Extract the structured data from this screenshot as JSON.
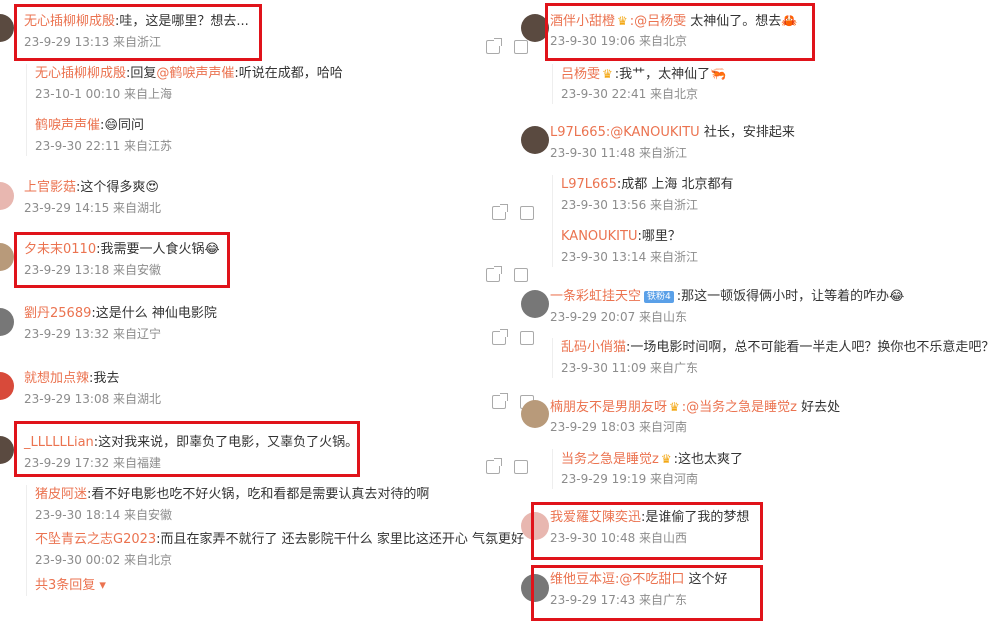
{
  "left": {
    "c1": {
      "name": "无心插柳柳成殷",
      "text": ":哇，这是哪里？想去...",
      "meta": "23-9-29 13:13 来自浙江"
    },
    "c1_replies": [
      {
        "name": "无心插柳柳成殷",
        "pre": ":回复",
        "at": "@鹤唳声声催",
        "text": ":听说在成都，哈哈",
        "meta": "23-10-1 00:10 来自上海"
      },
      {
        "name": "鹤唳声声催",
        "text": ":",
        "emoji": "😄",
        "text2": "同问",
        "meta": "23-9-30 22:11 来自江苏"
      }
    ],
    "c2": {
      "name": "上官影菇",
      "text": ":这个得多爽",
      "emoji": "😍",
      "meta": "23-9-29 14:15 来自湖北"
    },
    "c3": {
      "name": "夕未末0110",
      "text": ":我需要一人食火锅",
      "emoji": "😂",
      "meta": "23-9-29 13:18 来自安徽"
    },
    "c4": {
      "name": "劉丹25689",
      "text": ":这是什么 神仙电影院",
      "meta": "23-9-29 13:32 来自辽宁"
    },
    "c5": {
      "name": "就想加点辣",
      "text": ":我去",
      "meta": "23-9-29 13:08 来自湖北"
    },
    "c6": {
      "name": "_LLLLLLian",
      "text": ":这对我来说，即辜负了电影，又辜负了火锅。",
      "meta": "23-9-29 17:32 来自福建"
    },
    "c6_replies": [
      {
        "name": "猪皮阿迷",
        "text": ":看不好电影也吃不好火锅，吃和看都是需要认真去对待的啊",
        "meta": "23-9-30 18:14 来自安徽"
      },
      {
        "name": "不坠青云之志G2023",
        "text": ":而且在家弄不就行了 还去影院干什么 家里比这还开心 气氛更好",
        "meta": "23-9-30 00:02 来自北京"
      }
    ],
    "more_replies": "共3条回复 ▾"
  },
  "right": {
    "c1": {
      "name": "酒伴小甜橙",
      "at": ":@吕杨雯",
      "text": " 太神仙了。想去",
      "emoji": "🦀",
      "meta": "23-9-30 19:06 来自北京"
    },
    "c1_replies": [
      {
        "name": "吕杨雯",
        "text": ":我艹，太神仙了",
        "emoji": "🦐",
        "meta": "23-9-30 22:41 来自北京"
      }
    ],
    "c2": {
      "name": "L97L665",
      "at": ":@KANOUKITU",
      "text": " 社长，安排起来",
      "meta": "23-9-30 11:48 来自浙江"
    },
    "c2_replies": [
      {
        "name": "L97L665",
        "text": ":成都 上海 北京都有",
        "meta": "23-9-30 13:56 来自浙江"
      },
      {
        "name": "KANOUKITU",
        "text": ":哪里？",
        "meta": "23-9-30 13:14 来自浙江"
      }
    ],
    "c3": {
      "name": "一条彩虹挂天空",
      "badge": "铁粉4",
      "text": ":那这一顿饭得俩小时，让等着的咋办",
      "emoji": "😂",
      "meta": "23-9-29 20:07 来自山东"
    },
    "c3_replies": [
      {
        "name": "乱码小俏猫",
        "text": ":一场电影时间啊，总不可能看一半走人吧？换你也不乐意走吧？",
        "meta": "23-9-30 11:09 来自广东"
      }
    ],
    "c4": {
      "name": "楠朋友不是男朋友呀",
      "at": ":@当务之急是睡觉z",
      "text": " 好去处",
      "meta": "23-9-29 18:03 来自河南"
    },
    "c4_replies": [
      {
        "name": "当务之急是睡觉z",
        "text": ":这也太爽了",
        "meta": "23-9-29 19:19 来自河南"
      }
    ],
    "c5": {
      "name": "我爱羅艾陳奕迅",
      "text": ":是谁偷了我的梦想",
      "meta": "23-9-30 10:48 来自山西"
    },
    "c6": {
      "name": "维他豆本逗",
      "at": ":@不吃甜口",
      "text": " 这个好",
      "meta": "23-9-29 17:43 来自广东"
    }
  },
  "icons": {
    "share": "share-icon",
    "comment": "comment-icon",
    "crown": "crown-icon"
  },
  "colors": {
    "username": "#eb7350",
    "highlight": "#e0131a",
    "meta": "#8c8c8c"
  }
}
